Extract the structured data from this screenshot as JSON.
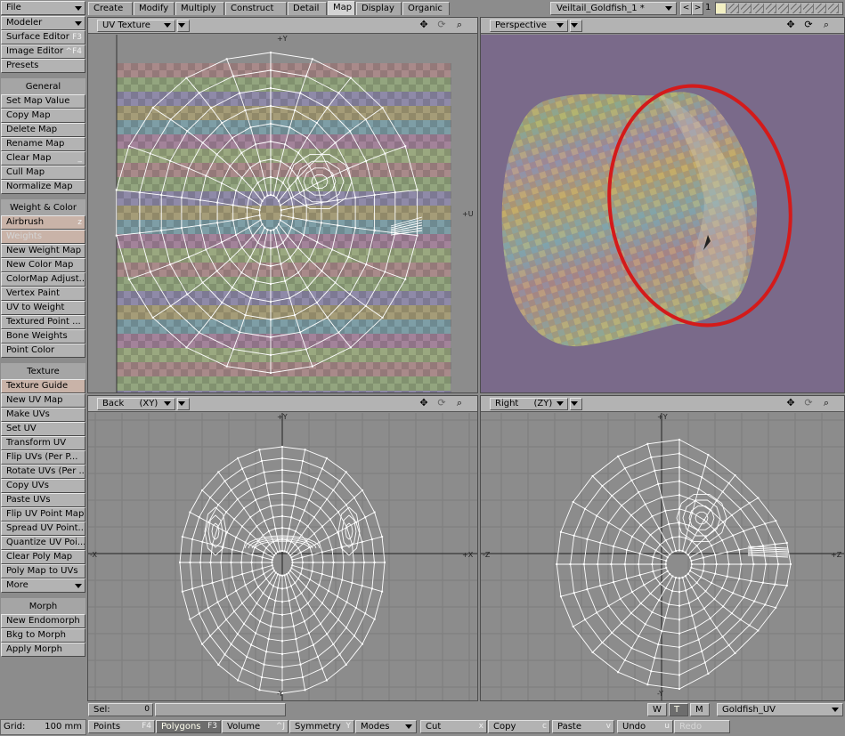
{
  "left_panel": {
    "buttons": [
      {
        "label": "File",
        "key": "",
        "dd": true
      },
      {
        "label": "Modeler",
        "key": "",
        "dd": true
      },
      {
        "label": "Surface Editor",
        "key": "F3"
      },
      {
        "label": "Image Editor",
        "key": "^F4"
      },
      {
        "label": "Presets",
        "key": ""
      }
    ],
    "general_header": "General",
    "general": [
      {
        "label": "Set Map Value"
      },
      {
        "label": "Copy Map"
      },
      {
        "label": "Delete Map"
      },
      {
        "label": "Rename Map"
      },
      {
        "label": "Clear Map",
        "key": "_"
      },
      {
        "label": "Cull Map"
      },
      {
        "label": "Normalize Map"
      }
    ],
    "weight_header": "Weight & Color",
    "weight": [
      {
        "label": "Airbrush",
        "key": "z"
      },
      {
        "label": "Weights"
      },
      {
        "label": "New Weight Map"
      },
      {
        "label": "New Color Map"
      },
      {
        "label": "ColorMap Adjust..."
      },
      {
        "label": "Vertex Paint"
      },
      {
        "label": "UV to Weight"
      },
      {
        "label": "Textured Point ..."
      },
      {
        "label": "Bone Weights"
      },
      {
        "label": "Point Color"
      }
    ],
    "texture_header": "Texture",
    "texture": [
      {
        "label": "Texture Guide"
      },
      {
        "label": "New UV Map"
      },
      {
        "label": "Make UVs"
      },
      {
        "label": "Set UV"
      },
      {
        "label": "Transform UV"
      },
      {
        "label": "Flip UVs (Per P..."
      },
      {
        "label": "Rotate UVs (Per ..."
      },
      {
        "label": "Copy UVs"
      },
      {
        "label": "Paste UVs"
      },
      {
        "label": "Flip UV Point Map"
      },
      {
        "label": "Spread UV Point..."
      },
      {
        "label": "Quantize UV Poi..."
      },
      {
        "label": "Clear Poly Map"
      },
      {
        "label": "Poly Map to UVs"
      },
      {
        "label": "More"
      }
    ],
    "morph_header": "Morph",
    "morph": [
      {
        "label": "New Endomorph"
      },
      {
        "label": "Bkg to Morph"
      },
      {
        "label": "Apply Morph"
      }
    ],
    "grid_label": "Grid:",
    "grid_value": "100 mm"
  },
  "tabs": [
    "Create",
    "Modify",
    "Multiply",
    "Construct",
    "Detail",
    "Map",
    "Display",
    "Organic"
  ],
  "active_tab": "Map",
  "scene_name": "Veiltail_Goldfish_1 *",
  "layer_number": "1",
  "viewports": [
    {
      "view": "UV Texture",
      "axis_top": "+Y",
      "axis_right": "+U"
    },
    {
      "view": "Perspective"
    },
    {
      "view": "Back",
      "plane": "(XY)",
      "axis_top": "+Y",
      "axis_left": "-X",
      "axis_right": "+X",
      "axis_bottom": "-Y"
    },
    {
      "view": "Right",
      "plane": "(ZY)",
      "axis_top": "+Y",
      "axis_left": "-Z",
      "axis_right": "+Z",
      "axis_bottom": "-Y"
    }
  ],
  "bottom": {
    "sel_label": "Sel:",
    "sel_value": "0",
    "wtm": [
      "W",
      "T",
      "M"
    ],
    "vmap": "Goldfish_UV",
    "modes": [
      {
        "label": "Points",
        "key": "F4"
      },
      {
        "label": "Polygons",
        "key": "F3"
      },
      {
        "label": "Volume",
        "key": "^J"
      },
      {
        "label": "Symmetry",
        "key": "Y"
      },
      {
        "label": "Modes"
      },
      {
        "label": "Cut",
        "key": "x"
      },
      {
        "label": "Copy",
        "key": "c"
      },
      {
        "label": "Paste",
        "key": "v"
      },
      {
        "label": "Undo",
        "key": "u"
      },
      {
        "label": "Redo"
      }
    ]
  },
  "colors": {
    "panel": "#b3b3b3",
    "viewport_bg": "#8c8c8c",
    "perspective_bg": "#7a6a8a",
    "highlight_circle": "#d41a1a",
    "wire": "#ffffff"
  }
}
